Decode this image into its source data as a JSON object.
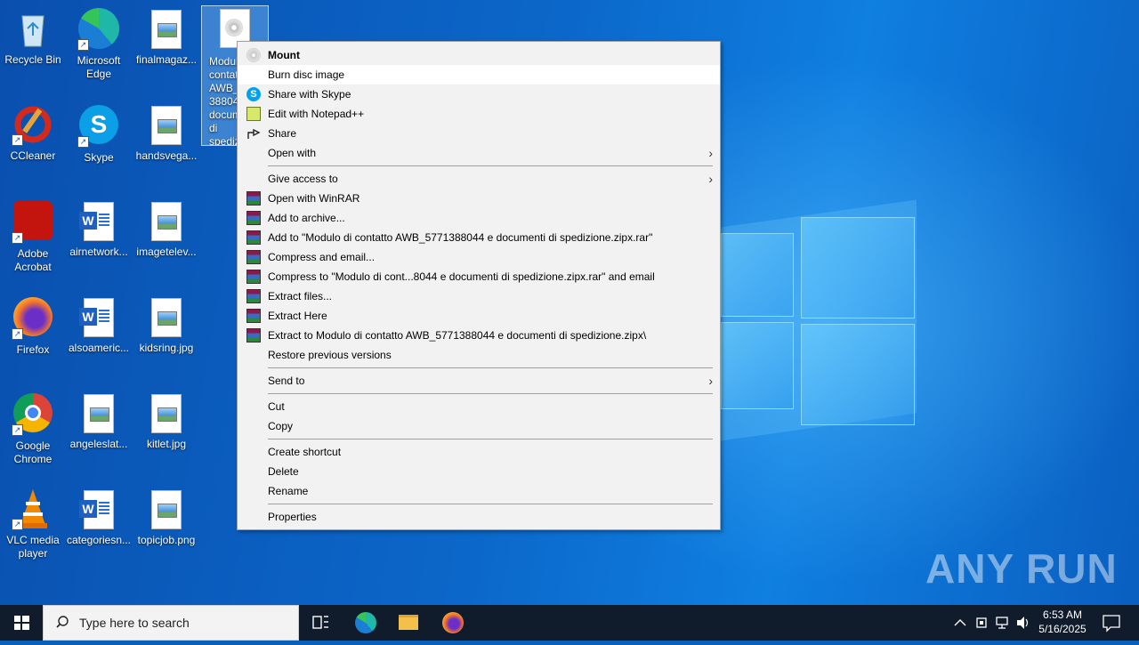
{
  "desktop": {
    "icons": [
      {
        "label": "Recycle Bin"
      },
      {
        "label": "Microsoft Edge"
      },
      {
        "label": "finalmagaz..."
      },
      {
        "label": "Modulo di contatto AWB_5771388044 e documenti di spedizione.zipx"
      },
      {
        "label": "CCleaner"
      },
      {
        "label": "Skype"
      },
      {
        "label": "handsvega..."
      },
      {
        "label": "Adobe Acrobat"
      },
      {
        "label": "airnetwork..."
      },
      {
        "label": "imagetelev..."
      },
      {
        "label": "Firefox"
      },
      {
        "label": "alsoameric..."
      },
      {
        "label": "kidsring.jpg"
      },
      {
        "label": "Google Chrome"
      },
      {
        "label": "angeleslat..."
      },
      {
        "label": "kitlet.jpg"
      },
      {
        "label": "VLC media player"
      },
      {
        "label": "categoriesn..."
      },
      {
        "label": "topicjob.png"
      }
    ],
    "selected_icon_visible_text": "Modu conte AWB_5 8044 docum spediz px.i"
  },
  "context_menu": {
    "items": [
      {
        "label": "Mount",
        "icon": "disc-icon",
        "bold": true
      },
      {
        "label": "Burn disc image",
        "highlighted": true
      },
      {
        "label": "Share with Skype",
        "icon": "skype-icon"
      },
      {
        "label": "Edit with Notepad++",
        "icon": "notepad-plus-icon"
      },
      {
        "label": "Share",
        "icon": "share-icon"
      },
      {
        "label": "Open with",
        "submenu": true
      },
      {
        "label": "Give access to",
        "submenu": true
      },
      {
        "label": "Open with WinRAR",
        "icon": "winrar-icon"
      },
      {
        "label": "Add to archive...",
        "icon": "winrar-icon"
      },
      {
        "label": "Add to \"Modulo di contatto AWB_5771388044 e documenti di spedizione.zipx.rar\"",
        "icon": "winrar-icon"
      },
      {
        "label": "Compress and email...",
        "icon": "winrar-icon"
      },
      {
        "label": "Compress to \"Modulo di cont...8044 e documenti di spedizione.zipx.rar\" and email",
        "icon": "winrar-icon"
      },
      {
        "label": "Extract files...",
        "icon": "winrar-icon"
      },
      {
        "label": "Extract Here",
        "icon": "winrar-icon"
      },
      {
        "label": "Extract to Modulo di contatto AWB_5771388044 e documenti di spedizione.zipx\\",
        "icon": "winrar-icon"
      },
      {
        "label": "Restore previous versions"
      },
      {
        "label": "Send to",
        "submenu": true
      },
      {
        "label": "Cut"
      },
      {
        "label": "Copy"
      },
      {
        "label": "Create shortcut"
      },
      {
        "label": "Delete"
      },
      {
        "label": "Rename"
      },
      {
        "label": "Properties"
      }
    ]
  },
  "watermark": "ANY RUN",
  "taskbar": {
    "search_placeholder": "Type here to search",
    "clock_time": "6:53 AM",
    "clock_date": "5/16/2025"
  },
  "colors": {
    "taskbar": "#101b2b",
    "menu_bg": "#f2f2f2",
    "menu_highlight": "#ffffff"
  }
}
